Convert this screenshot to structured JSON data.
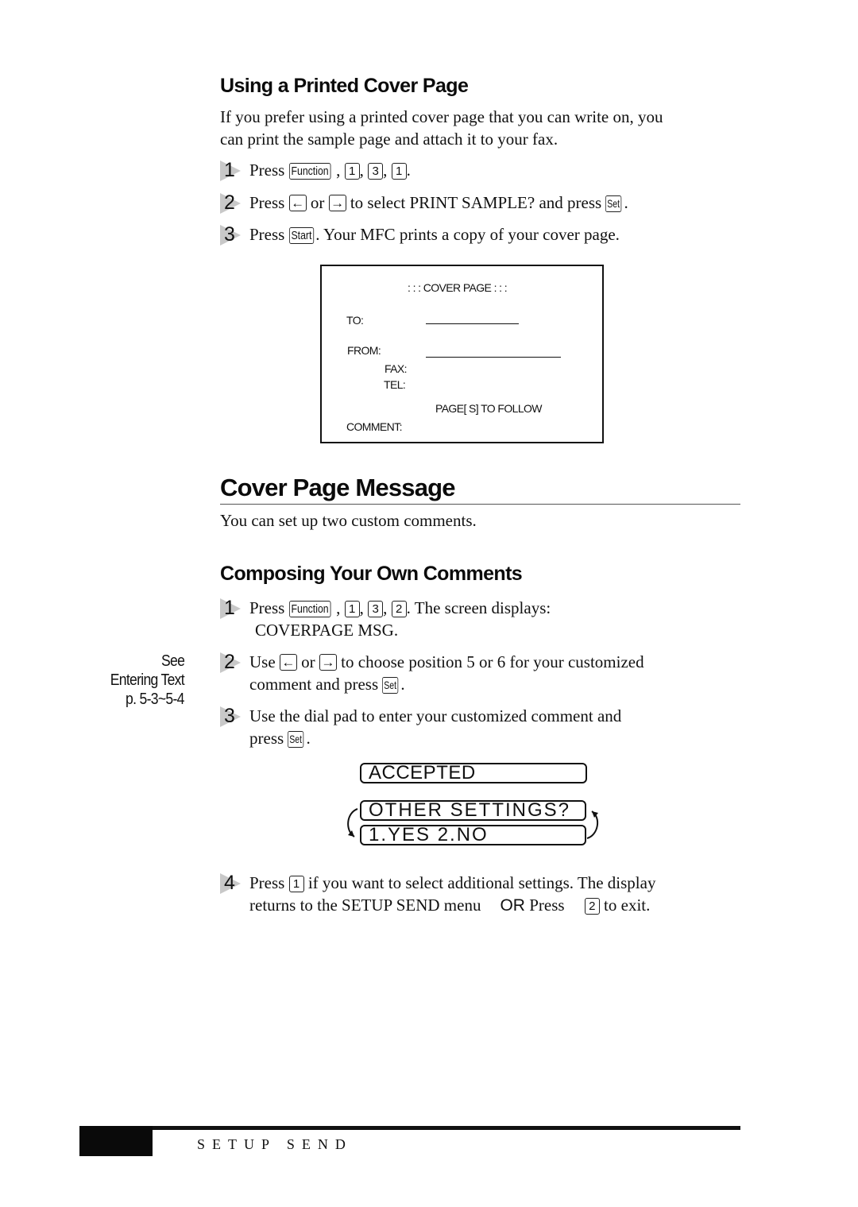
{
  "section1": {
    "heading": "Using a Printed Cover Page",
    "intro_line1": "If you prefer using a printed cover page that you can write on, you",
    "intro_line2": "can print the sample page and attach it to your fax.",
    "steps": [
      {
        "num": "1",
        "pre": "Press ",
        "keys": [
          "Function",
          "1",
          "3",
          "1"
        ],
        "post": "."
      },
      {
        "num": "2",
        "pre": "Press ",
        "k_left": "←",
        "mid1": " or ",
        "k_right": "→",
        "mid2": " to select PRINT SAMPLE? and press ",
        "k_set": "Set",
        "post": "."
      },
      {
        "num": "3",
        "pre": "Press ",
        "k_start": "Start",
        "post": ". Your MFC prints a copy of your cover page."
      }
    ]
  },
  "cover_sample": {
    "title": ": : :  COVER  PAGE : : :",
    "to_label": "TO:",
    "from_label": "FROM:",
    "fax_label": "FAX:",
    "tel_label": "TEL:",
    "pages_label": "PAGE[ S]   TO  FOLLOW",
    "comment_label": "COMMENT:"
  },
  "section2": {
    "heading": "Cover Page Message",
    "intro": "You can set up two custom comments."
  },
  "section3": {
    "heading": "Composing Your Own Comments",
    "step1": {
      "num": "1",
      "pre": "Press ",
      "keys": [
        "Function",
        "1",
        "3",
        "2"
      ],
      "post": ". The screen displays:",
      "line2": "COVERPAGE MSG."
    },
    "step2": {
      "num": "2",
      "pre": "Use ",
      "k_left": "←",
      "mid1": " or ",
      "k_right": "→",
      "mid2": " to choose position 5 or 6 for your customized",
      "line2_pre": "comment and press ",
      "k_set": "Set",
      "post": "."
    },
    "step3": {
      "num": "3",
      "line1": "Use the dial pad to enter your customized comment and",
      "line2_pre": "press ",
      "k_set": "Set",
      "post": "."
    },
    "step4": {
      "num": "4",
      "pre": "Press ",
      "k1": "1",
      "mid": " if you want to select additional settings. The display",
      "line2_pre": "returns to the SETUP SEND menu",
      "or": "OR",
      "line2_mid": " Press ",
      "k2": "2",
      "post": " to exit."
    }
  },
  "sidebar_note": {
    "line1": "See",
    "line2": "Entering Text",
    "line3": "p. 5-3~5-4"
  },
  "lcd": {
    "accepted": "ACCEPTED",
    "other_settings": "OTHER SETTINGS?",
    "yes_no": "1.YES 2.NO"
  },
  "footer": {
    "section_title": "SETUP SEND"
  }
}
